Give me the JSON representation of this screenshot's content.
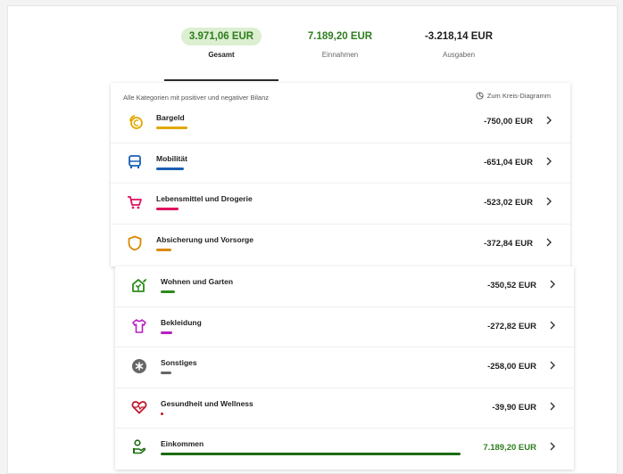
{
  "tabs": [
    {
      "amount": "3.971,06 EUR",
      "label": "Gesamt",
      "color": "#2e7d1e",
      "active": true
    },
    {
      "amount": "7.189,20 EUR",
      "label": "Einnahmen",
      "color": "#2e7d1e",
      "active": false
    },
    {
      "amount": "-3.218,14 EUR",
      "label": "Ausgaben",
      "color": "#1f1f1f",
      "active": false
    }
  ],
  "list": {
    "hint": "Alle Kategorien mit positiver und negativer Bilanz",
    "pie_link": "Zum Kreis-Diagramm",
    "pie_icon": "pie-chart-icon",
    "chevron_icon": "chevron-right-icon"
  },
  "categories": [
    {
      "name": "Bargeld",
      "amount": "-750,00 EUR",
      "icon": "coins-icon",
      "color": "#e0a800",
      "share": 0.104
    },
    {
      "name": "Mobilität",
      "amount": "-651,04 EUR",
      "icon": "bus-icon",
      "color": "#1a5fb4",
      "share": 0.091
    },
    {
      "name": "Lebensmittel und Drogerie",
      "amount": "-523,02 EUR",
      "icon": "cart-icon",
      "color": "#e0105f",
      "share": 0.073
    },
    {
      "name": "Absicherung und Vorsorge",
      "amount": "-372,84 EUR",
      "icon": "shield-icon",
      "color": "#d98a00",
      "share": 0.052
    },
    {
      "name": "Wohnen und Garten",
      "amount": "-350,52 EUR",
      "icon": "house-plant-icon",
      "color": "#2e8b1e",
      "share": 0.049
    },
    {
      "name": "Bekleidung",
      "amount": "-272,82 EUR",
      "icon": "shirt-icon",
      "color": "#b620c0",
      "share": 0.038
    },
    {
      "name": "Sonstiges",
      "amount": "-258,00 EUR",
      "icon": "asterisk-icon",
      "color": "#666666",
      "share": 0.036
    },
    {
      "name": "Gesundheit und Wellness",
      "amount": "-39,90 EUR",
      "icon": "heart-pulse-icon",
      "color": "#c0172b",
      "share": 0.006
    },
    {
      "name": "Einkommen",
      "amount": "7.189,20 EUR",
      "icon": "income-hand-icon",
      "color": "#1b6b10",
      "share": 1.0,
      "amount_color": "#2e7d1e"
    }
  ]
}
